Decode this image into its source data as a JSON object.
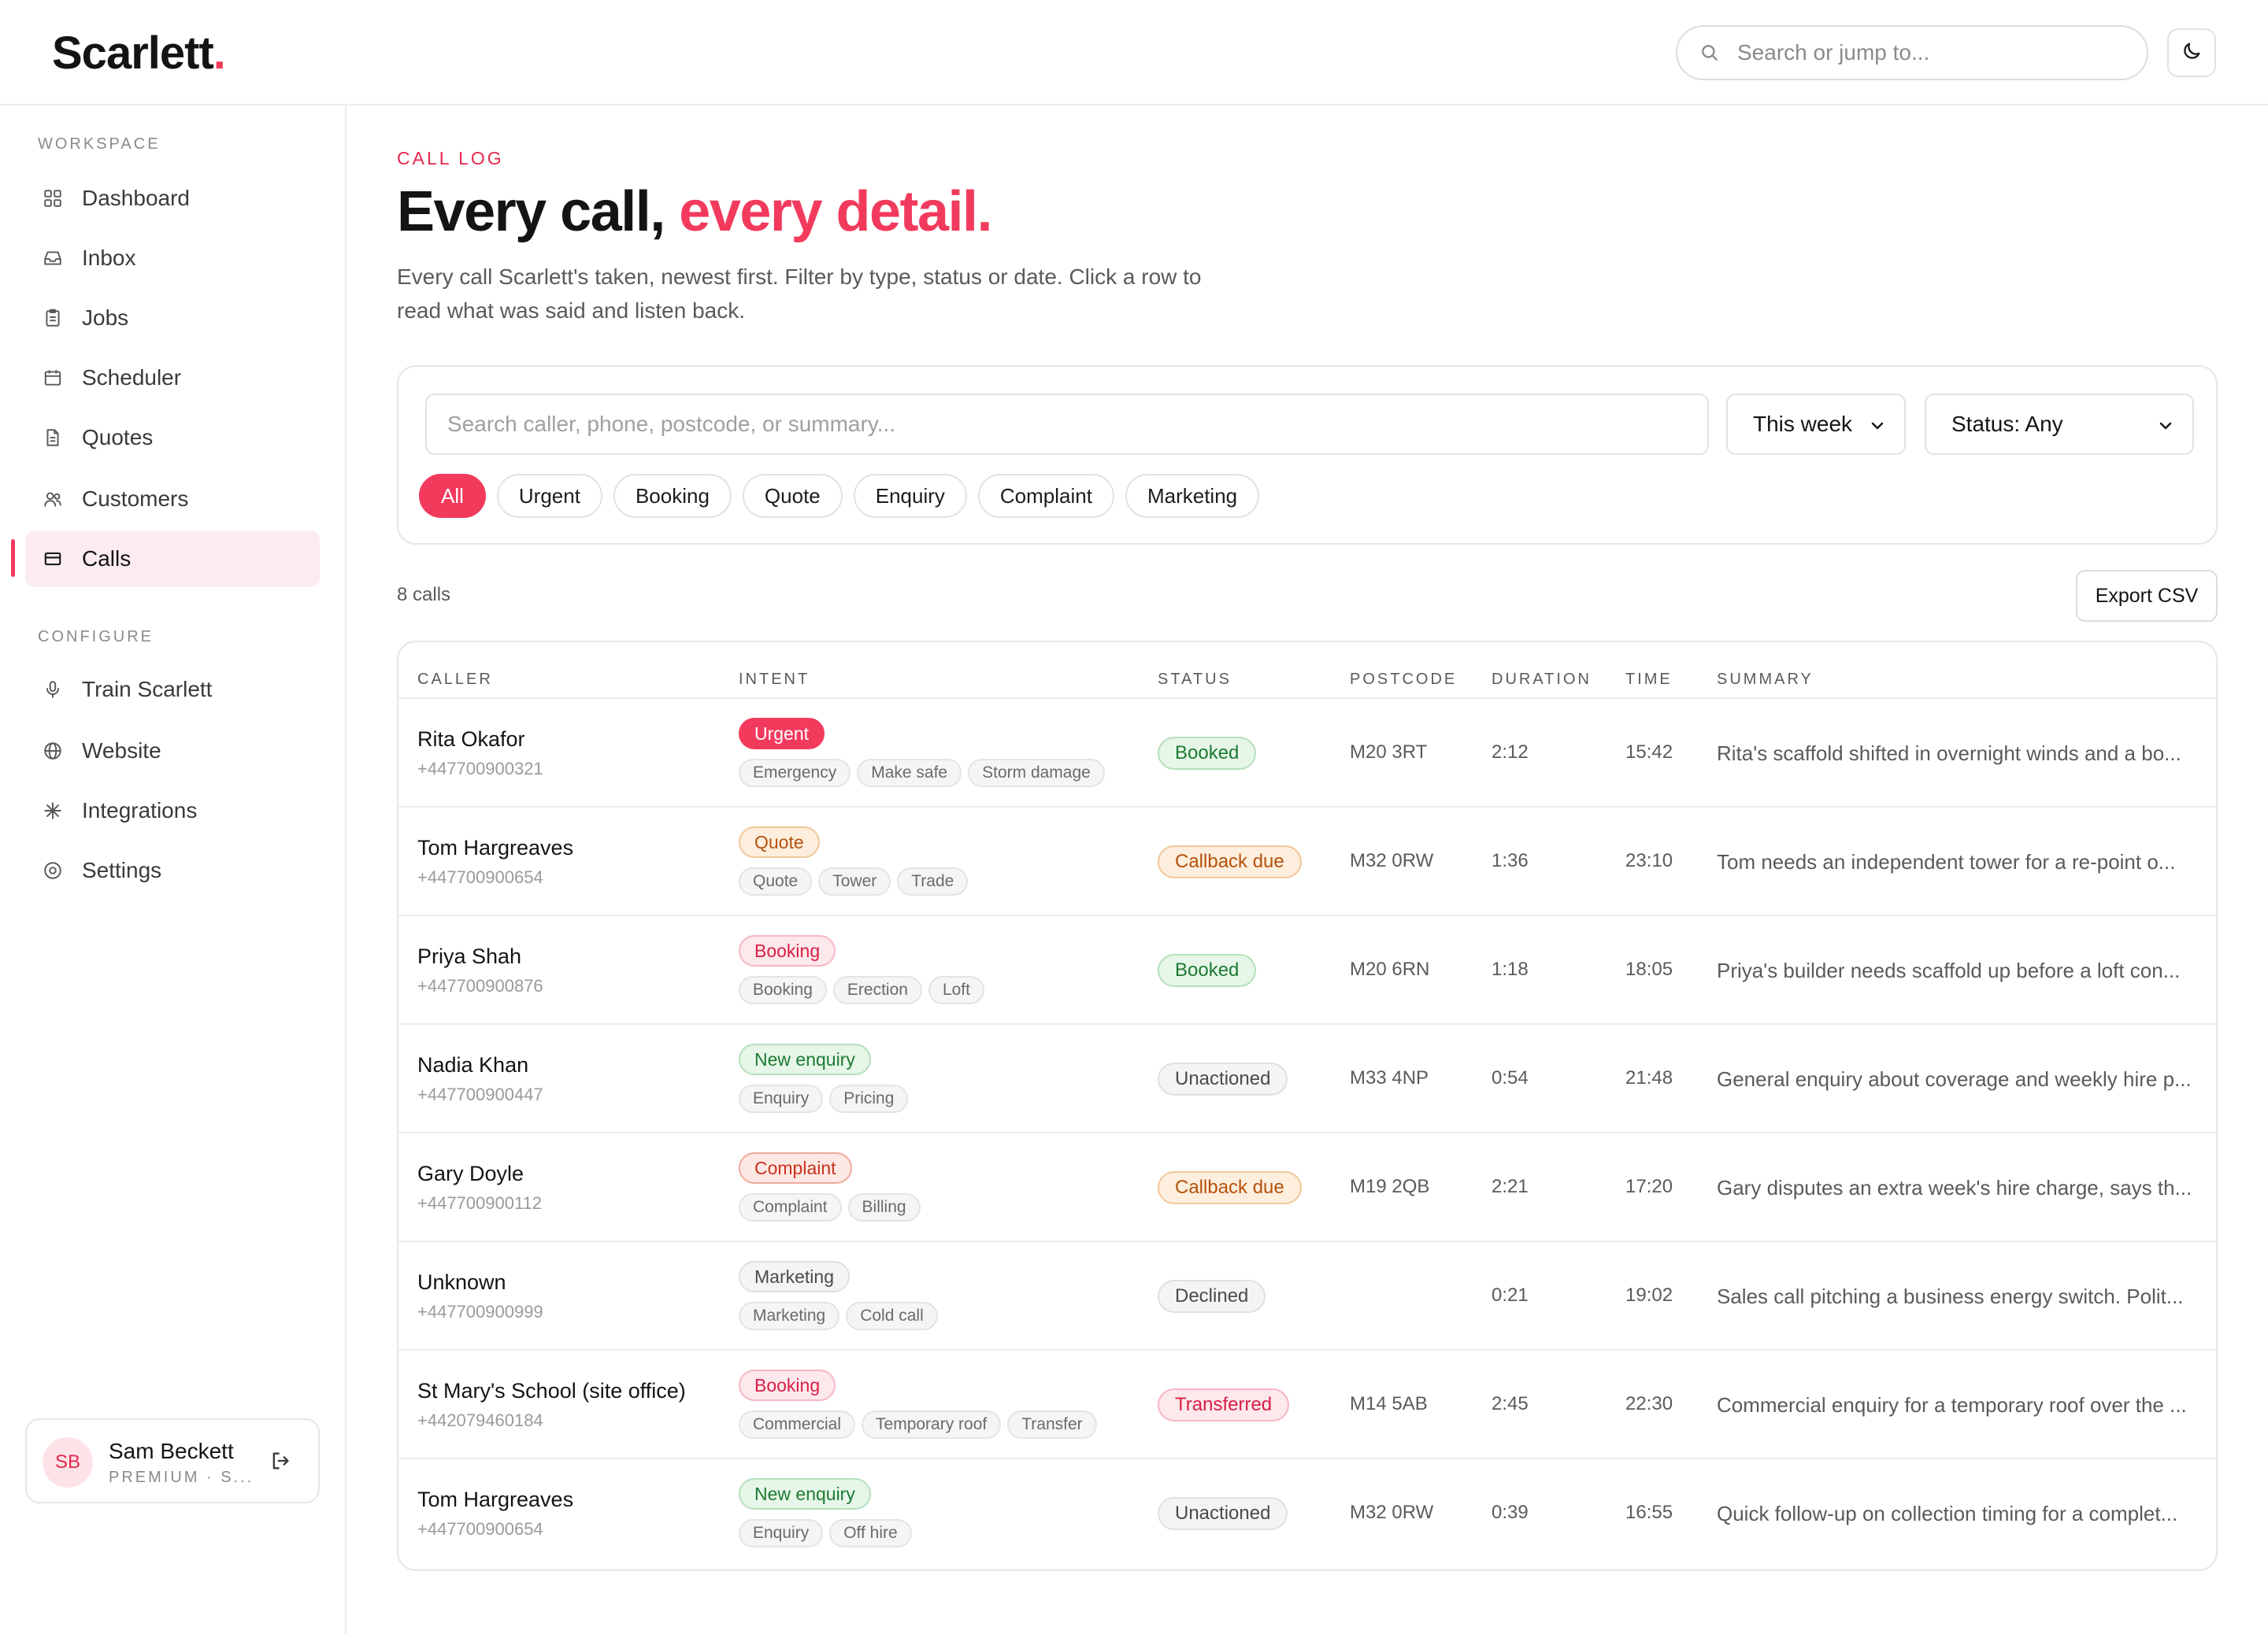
{
  "app": {
    "logo_text": "Scarlett",
    "logo_dot": ".",
    "accent_color": "#f23a5d"
  },
  "topbar": {
    "search_placeholder": "Search or jump to...",
    "theme_toggle_icon": "moon-icon"
  },
  "sidebar": {
    "workspace_label": "WORKSPACE",
    "configure_label": "CONFIGURE",
    "workspace_items": [
      {
        "label": "Dashboard",
        "icon": "dashboard-icon"
      },
      {
        "label": "Inbox",
        "icon": "inbox-icon"
      },
      {
        "label": "Jobs",
        "icon": "clipboard-icon"
      },
      {
        "label": "Scheduler",
        "icon": "calendar-icon"
      },
      {
        "label": "Quotes",
        "icon": "document-icon"
      },
      {
        "label": "Customers",
        "icon": "users-icon"
      },
      {
        "label": "Calls",
        "icon": "calls-icon",
        "active": true
      }
    ],
    "configure_items": [
      {
        "label": "Train Scarlett",
        "icon": "microphone-icon"
      },
      {
        "label": "Website",
        "icon": "globe-icon"
      },
      {
        "label": "Integrations",
        "icon": "sparkle-icon"
      },
      {
        "label": "Settings",
        "icon": "settings-icon"
      }
    ],
    "user": {
      "initials": "SB",
      "name": "Sam Beckett",
      "plan": "PREMIUM · S..."
    }
  },
  "header": {
    "eyebrow": "CALL LOG",
    "title_main": "Every call,",
    "title_accent": "every detail.",
    "subtitle": "Every call Scarlett's taken, newest first. Filter by type, status or date. Click a row to read what was said and listen back."
  },
  "filters": {
    "search_placeholder": "Search caller, phone, postcode, or summary...",
    "date_select": "This week",
    "status_select": "Status: Any",
    "chips": [
      "All",
      "Urgent",
      "Booking",
      "Quote",
      "Enquiry",
      "Complaint",
      "Marketing"
    ],
    "active_chip": "All"
  },
  "summary_bar": {
    "count": "8 calls",
    "export_label": "Export CSV"
  },
  "table": {
    "columns": [
      "CALLER",
      "INTENT",
      "STATUS",
      "POSTCODE",
      "DURATION",
      "TIME",
      "SUMMARY"
    ],
    "rows": [
      {
        "caller": "Rita Okafor",
        "phone": "+447700900321",
        "intent": "Urgent",
        "intent_style": "solid-red",
        "tags": [
          "Emergency",
          "Make safe",
          "Storm damage"
        ],
        "status": "Booked",
        "status_style": "green",
        "postcode": "M20 3RT",
        "duration": "2:12",
        "time": "15:42",
        "summary": "Rita's scaffold shifted in overnight winds and a bo..."
      },
      {
        "caller": "Tom Hargreaves",
        "phone": "+447700900654",
        "intent": "Quote",
        "intent_style": "orange",
        "tags": [
          "Quote",
          "Tower",
          "Trade"
        ],
        "status": "Callback due",
        "status_style": "orange",
        "postcode": "M32 0RW",
        "duration": "1:36",
        "time": "23:10",
        "summary": "Tom needs an independent tower for a re-point o..."
      },
      {
        "caller": "Priya Shah",
        "phone": "+447700900876",
        "intent": "Booking",
        "intent_style": "pink",
        "tags": [
          "Booking",
          "Erection",
          "Loft"
        ],
        "status": "Booked",
        "status_style": "green",
        "postcode": "M20 6RN",
        "duration": "1:18",
        "time": "18:05",
        "summary": "Priya's builder needs scaffold up before a loft con..."
      },
      {
        "caller": "Nadia Khan",
        "phone": "+447700900447",
        "intent": "New enquiry",
        "intent_style": "green",
        "tags": [
          "Enquiry",
          "Pricing"
        ],
        "status": "Unactioned",
        "status_style": "grey",
        "postcode": "M33 4NP",
        "duration": "0:54",
        "time": "21:48",
        "summary": "General enquiry about coverage and weekly hire p..."
      },
      {
        "caller": "Gary Doyle",
        "phone": "+447700900112",
        "intent": "Complaint",
        "intent_style": "red-outline",
        "tags": [
          "Complaint",
          "Billing"
        ],
        "status": "Callback due",
        "status_style": "orange",
        "postcode": "M19 2QB",
        "duration": "2:21",
        "time": "17:20",
        "summary": "Gary disputes an extra week's hire charge, says th..."
      },
      {
        "caller": "Unknown",
        "phone": "+447700900999",
        "intent": "Marketing",
        "intent_style": "grey",
        "tags": [
          "Marketing",
          "Cold call"
        ],
        "status": "Declined",
        "status_style": "grey",
        "postcode": "",
        "duration": "0:21",
        "time": "19:02",
        "summary": "Sales call pitching a business energy switch. Polit..."
      },
      {
        "caller": "St Mary's School (site office)",
        "phone": "+442079460184",
        "intent": "Booking",
        "intent_style": "pink",
        "tags": [
          "Commercial",
          "Temporary roof",
          "Transfer"
        ],
        "status": "Transferred",
        "status_style": "pink",
        "postcode": "M14 5AB",
        "duration": "2:45",
        "time": "22:30",
        "summary": "Commercial enquiry for a temporary roof over the ..."
      },
      {
        "caller": "Tom Hargreaves",
        "phone": "+447700900654",
        "intent": "New enquiry",
        "intent_style": "green",
        "tags": [
          "Enquiry",
          "Off hire"
        ],
        "status": "Unactioned",
        "status_style": "grey",
        "postcode": "M32 0RW",
        "duration": "0:39",
        "time": "16:55",
        "summary": "Quick follow-up on collection timing for a complet..."
      }
    ]
  },
  "pill_colors": {
    "solid-red": {
      "bg": "#f23a5d",
      "fg": "#ffffff",
      "border": "#f23a5d"
    },
    "orange": {
      "bg": "#fdeedd",
      "fg": "#b5520c",
      "border": "#f1c79a"
    },
    "pink": {
      "bg": "#fde8ec",
      "fg": "#d81e45",
      "border": "#f6b7c4"
    },
    "green": {
      "bg": "#e6f6e8",
      "fg": "#1d7a33",
      "border": "#b5e0bd"
    },
    "red-outline": {
      "bg": "#fde8e4",
      "fg": "#c8321e",
      "border": "#f1a99c"
    },
    "grey": {
      "bg": "#f4f4f4",
      "fg": "#4a4a4e",
      "border": "#e0e0e0"
    }
  }
}
